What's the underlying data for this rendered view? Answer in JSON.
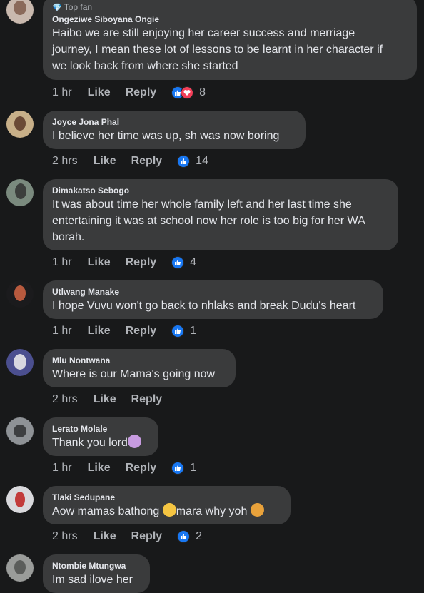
{
  "comments": [
    {
      "author": "Ongeziwe Siboyana Ongie",
      "badge": "Top fan",
      "lines": [
        "Haibo we are still enjoying her career success and merriage",
        "journey,  I mean these lot of lessons to be learnt in her character if",
        "we look back from where she started"
      ],
      "time": "1 hr",
      "like": "Like",
      "reply": "Reply",
      "reactions": "8"
    },
    {
      "author": "Joyce Jona Phal",
      "lines": [
        "I believe her time was up,  sh was now boring"
      ],
      "time": "2 hrs",
      "like": "Like",
      "reply": "Reply",
      "reactions": "14"
    },
    {
      "author": "Dimakatso Sebogo",
      "lines": [
        "It was about time her whole family left and her last time she",
        "entertaining it was at school now her role is too big for her WA",
        "borah."
      ],
      "time": "1 hr",
      "like": "Like",
      "reply": "Reply",
      "reactions": "4"
    },
    {
      "author": "Utlwang Manake",
      "lines": [
        "I hope Vuvu won't go back to nhlaks and break Dudu's heart"
      ],
      "time": "1 hr",
      "like": "Like",
      "reply": "Reply",
      "reactions": "1"
    },
    {
      "author": "Mlu Nontwana",
      "lines": [
        "Where is our Mama's going now"
      ],
      "time": "2 hrs",
      "like": "Like",
      "reply": "Reply"
    },
    {
      "author": "Lerato Molale",
      "lines": [
        "Thank you lord"
      ],
      "time": "1 hr",
      "like": "Like",
      "reply": "Reply",
      "reactions": "1"
    },
    {
      "author": "Tlaki Sedupane",
      "text_a": "Aow mamas bathong ",
      "text_b": "mara why yoh ",
      "time": "2 hrs",
      "like": "Like",
      "reply": "Reply",
      "reactions": "2"
    },
    {
      "author": "Ntombie Mtungwa",
      "lines": [
        "Im sad ilove her"
      ]
    }
  ],
  "colors": {
    "background": "#18191a",
    "bubble": "#3a3b3c",
    "like": "#1877f2",
    "love": "#f33e58",
    "muted": "#b0b3b8"
  },
  "icons": [
    "top-fan-gem-icon",
    "like-reaction-icon",
    "love-reaction-icon",
    "woman-praying-emoji",
    "crying-face-emoji",
    "woman-emoji"
  ]
}
